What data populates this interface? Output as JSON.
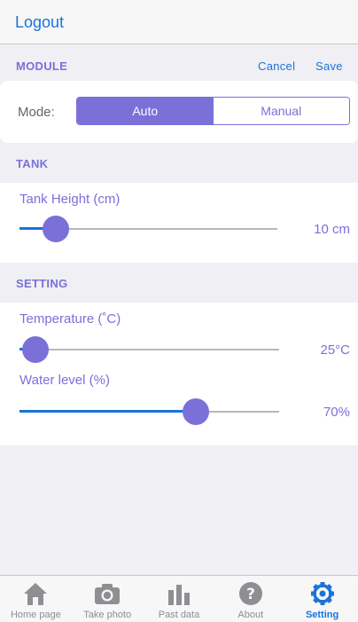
{
  "nav": {
    "logout_label": "Logout"
  },
  "module": {
    "header": "MODULE",
    "cancel_label": "Cancel",
    "save_label": "Save",
    "mode_label": "Mode:",
    "modes": [
      "Auto",
      "Manual"
    ],
    "selected_mode": "Auto"
  },
  "tank": {
    "header": "TANK",
    "height_label": "Tank Height (cm)",
    "height_value": "10 cm",
    "height_fraction": 0.14
  },
  "setting": {
    "header": "SETTING",
    "temperature_label": "Temperature (˚C)",
    "temperature_value": "25°C",
    "temperature_fraction": 0.06,
    "water_label": "Water level (%)",
    "water_value": "70%",
    "water_fraction": 0.68
  },
  "tabs": [
    {
      "label": "Home page",
      "icon": "home-icon",
      "active": false
    },
    {
      "label": "Take photo",
      "icon": "camera-icon",
      "active": false
    },
    {
      "label": "Past data",
      "icon": "bar-chart-icon",
      "active": false
    },
    {
      "label": "About",
      "icon": "question-icon",
      "active": false
    },
    {
      "label": "Setting",
      "icon": "gear-icon",
      "active": true
    }
  ],
  "colors": {
    "accent": "#7b70d8",
    "link": "#1a73d9",
    "tab_inactive": "#8e8e93"
  }
}
